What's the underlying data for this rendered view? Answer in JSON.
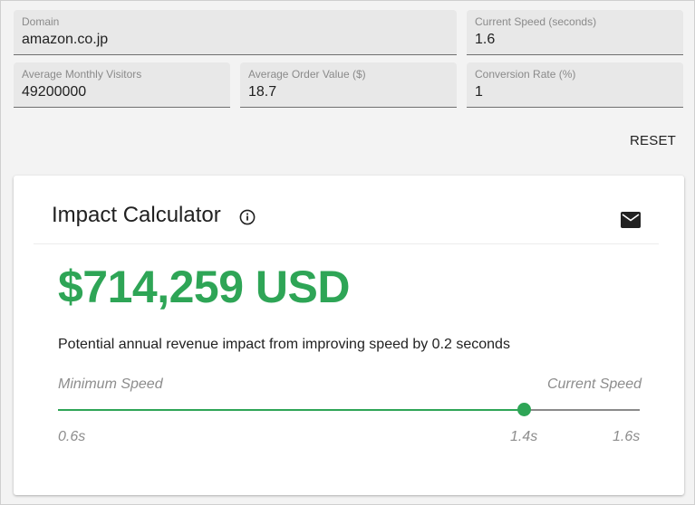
{
  "inputs": {
    "domain": {
      "label": "Domain",
      "value": "amazon.co.jp"
    },
    "current_speed": {
      "label": "Current Speed (seconds)",
      "value": "1.6"
    },
    "visitors": {
      "label": "Average Monthly Visitors",
      "value": "49200000"
    },
    "order_value": {
      "label": "Average Order Value ($)",
      "value": "18.7"
    },
    "conversion": {
      "label": "Conversion Rate (%)",
      "value": "1"
    }
  },
  "reset_label": "RESET",
  "card": {
    "title": "Impact Calculator",
    "impact_value": "$714,259 USD",
    "description": "Potential annual revenue impact from improving speed by 0.2 seconds",
    "min_label": "Minimum Speed",
    "current_label": "Current Speed"
  },
  "slider": {
    "min": 0.6,
    "max": 1.6,
    "value": 1.4,
    "min_label": "0.6s",
    "value_label": "1.4s",
    "max_label": "1.6s"
  },
  "colors": {
    "accent": "#2ea556"
  },
  "icons": {
    "info": "info-icon",
    "mail": "mail-icon"
  }
}
